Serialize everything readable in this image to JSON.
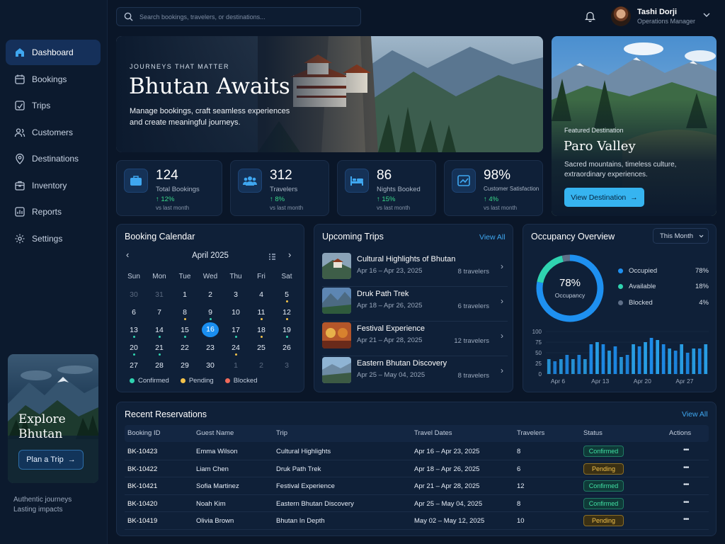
{
  "app": {
    "search_placeholder": "Search bookings, travelers, or destinations..."
  },
  "user": {
    "name": "Tashi Dorji",
    "role": "Operations Manager"
  },
  "sidebar": {
    "items": [
      {
        "label": "Dashboard",
        "icon": "home-icon",
        "active": true
      },
      {
        "label": "Bookings",
        "icon": "calendar-icon"
      },
      {
        "label": "Trips",
        "icon": "map-icon"
      },
      {
        "label": "Customers",
        "icon": "users-icon"
      },
      {
        "label": "Destinations",
        "icon": "pin-icon"
      },
      {
        "label": "Inventory",
        "icon": "box-icon"
      },
      {
        "label": "Reports",
        "icon": "chart-icon"
      },
      {
        "label": "Settings",
        "icon": "gear-icon"
      }
    ],
    "promo": {
      "title1": "Explore",
      "title2": "Bhutan",
      "button": "Plan a Trip"
    },
    "tagline1": "Authentic journeys",
    "tagline2": "Lasting impacts"
  },
  "hero": {
    "kicker": "JOURNEYS THAT MATTER",
    "title": "Bhutan Awaits",
    "sub1": "Manage bookings, craft seamless experiences",
    "sub2": "and create meaningful journeys."
  },
  "featured": {
    "kicker": "Featured Destination",
    "title": "Paro Valley",
    "sub": "Sacred mountains, timeless culture, extraordinary experiences.",
    "button": "View Destination"
  },
  "stats": [
    {
      "value": "124",
      "label": "Total Bookings",
      "delta": "12%",
      "note": "vs last month",
      "icon": "briefcase-icon"
    },
    {
      "value": "312",
      "label": "Travelers",
      "delta": "8%",
      "note": "vs last month",
      "icon": "group-icon"
    },
    {
      "value": "86",
      "label": "Nights Booked",
      "delta": "15%",
      "note": "vs last month",
      "icon": "bed-icon"
    },
    {
      "value": "98%",
      "label": "Customer Satisfaction",
      "delta": "4%",
      "note": "vs last month",
      "icon": "chart-box-icon"
    }
  ],
  "calendar": {
    "title": "Booking Calendar",
    "month": "April 2025",
    "dow": [
      "Sun",
      "Mon",
      "Tue",
      "Wed",
      "Thu",
      "Fri",
      "Sat"
    ],
    "weeks": [
      [
        [
          "30",
          "dim",
          ""
        ],
        [
          "31",
          "dim",
          ""
        ],
        [
          "1",
          "",
          ""
        ],
        [
          "2",
          "",
          ""
        ],
        [
          "3",
          "",
          ""
        ],
        [
          "4",
          "",
          ""
        ],
        [
          "5",
          "",
          "y"
        ]
      ],
      [
        [
          "6",
          "",
          ""
        ],
        [
          "7",
          "",
          ""
        ],
        [
          "8",
          "",
          "y"
        ],
        [
          "9",
          "",
          "g"
        ],
        [
          "10",
          "",
          ""
        ],
        [
          "11",
          "",
          "y"
        ],
        [
          "12",
          "",
          "y"
        ]
      ],
      [
        [
          "13",
          "",
          "g"
        ],
        [
          "14",
          "",
          "g"
        ],
        [
          "15",
          "",
          "g"
        ],
        [
          "16",
          "sel",
          ""
        ],
        [
          "17",
          "",
          "g"
        ],
        [
          "18",
          "",
          "y"
        ],
        [
          "19",
          "",
          "g"
        ]
      ],
      [
        [
          "20",
          "",
          "g"
        ],
        [
          "21",
          "",
          "g"
        ],
        [
          "22",
          "",
          ""
        ],
        [
          "23",
          "",
          ""
        ],
        [
          "24",
          "",
          "y"
        ],
        [
          "25",
          "",
          ""
        ],
        [
          "26",
          "",
          ""
        ]
      ],
      [
        [
          "27",
          "",
          ""
        ],
        [
          "28",
          "",
          ""
        ],
        [
          "29",
          "",
          ""
        ],
        [
          "30",
          "",
          ""
        ],
        [
          "1",
          "dim",
          ""
        ],
        [
          "2",
          "dim",
          ""
        ],
        [
          "3",
          "dim",
          ""
        ]
      ]
    ],
    "legend": [
      "Confirmed",
      "Pending",
      "Blocked"
    ],
    "colors": {
      "confirmed": "#2fd3b0",
      "pending": "#f3c24a",
      "blocked": "#f06a5a"
    }
  },
  "trips": {
    "title": "Upcoming Trips",
    "view_all": "View All",
    "items": [
      {
        "name": "Cultural Highlights of Bhutan",
        "dates": "Apr 16 – Apr 23, 2025",
        "count": "8 travelers"
      },
      {
        "name": "Druk Path Trek",
        "dates": "Apr 18 – Apr 26, 2025",
        "count": "6 travelers"
      },
      {
        "name": "Festival Experience",
        "dates": "Apr 21 – Apr 28, 2025",
        "count": "12 travelers"
      },
      {
        "name": "Eastern Bhutan Discovery",
        "dates": "Apr 25 – May 04, 2025",
        "count": "8 travelers"
      }
    ]
  },
  "occupancy": {
    "title": "Occupancy Overview",
    "period": "This Month",
    "center_value": "78%",
    "center_label": "Occupancy",
    "legend": [
      {
        "label": "Occupied",
        "value": "78%",
        "color": "#1e90f0"
      },
      {
        "label": "Available",
        "value": "18%",
        "color": "#2fd3b0"
      },
      {
        "label": "Blocked",
        "value": "4%",
        "color": "#5e6f88"
      }
    ]
  },
  "chart_data": {
    "type": "bar",
    "yticks": [
      "100",
      "75",
      "50",
      "25",
      "0"
    ],
    "ylim": [
      0,
      100
    ],
    "xticks": [
      "Apr 6",
      "Apr 13",
      "Apr 20",
      "Apr 27"
    ],
    "values": [
      35,
      30,
      35,
      45,
      35,
      45,
      35,
      70,
      75,
      70,
      55,
      65,
      40,
      45,
      70,
      65,
      75,
      85,
      80,
      70,
      60,
      55,
      70,
      50,
      60,
      60,
      70
    ],
    "donut": [
      78,
      18,
      4
    ]
  },
  "reservations": {
    "title": "Recent Reservations",
    "view_all": "View All",
    "headers": [
      "Booking ID",
      "Guest Name",
      "Trip",
      "Travel Dates",
      "Travelers",
      "Status",
      "Actions"
    ],
    "rows": [
      {
        "id": "BK-10423",
        "guest": "Emma Wilson",
        "trip": "Cultural Highlights",
        "dates": "Apr 16 – Apr 23, 2025",
        "travelers": "8",
        "status": "Confirmed"
      },
      {
        "id": "BK-10422",
        "guest": "Liam Chen",
        "trip": "Druk Path Trek",
        "dates": "Apr 18 – Apr 26, 2025",
        "travelers": "6",
        "status": "Pending"
      },
      {
        "id": "BK-10421",
        "guest": "Sofia Martinez",
        "trip": "Festival Experience",
        "dates": "Apr 21 – Apr 28, 2025",
        "travelers": "12",
        "status": "Confirmed"
      },
      {
        "id": "BK-10420",
        "guest": "Noah Kim",
        "trip": "Eastern Bhutan Discovery",
        "dates": "Apr 25 – May 04, 2025",
        "travelers": "8",
        "status": "Confirmed"
      },
      {
        "id": "BK-10419",
        "guest": "Olivia Brown",
        "trip": "Bhutan In Depth",
        "dates": "May 02 – May 12, 2025",
        "travelers": "10",
        "status": "Pending"
      }
    ],
    "actions_glyph": "•••"
  }
}
